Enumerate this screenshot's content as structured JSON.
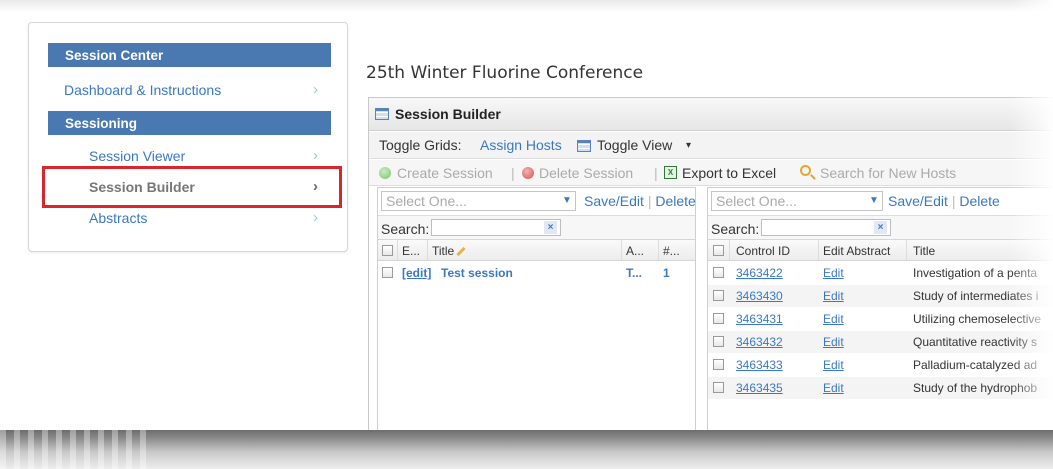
{
  "sidebar": {
    "header1": "Session Center",
    "items": [
      {
        "label": "Dashboard & Instructions"
      },
      {
        "label": "Session Viewer"
      },
      {
        "label": "Session Builder"
      },
      {
        "label": "Abstracts"
      }
    ],
    "header2": "Sessioning",
    "chevron": "›"
  },
  "conference_title": "25th Winter Fluorine Conference",
  "panel": {
    "title": "Session Builder",
    "toolbar1": {
      "toggle_grids_label": "Toggle Grids:",
      "assign_hosts": "Assign Hosts",
      "toggle_view": "Toggle View",
      "toggle_view_caret": "▾"
    },
    "toolbar2": {
      "create_session": "Create Session",
      "delete_session": "Delete Session",
      "export_excel": "Export to Excel",
      "search_hosts": "Search for New Hosts",
      "separator": "|"
    }
  },
  "left_grid": {
    "select_placeholder": "Select One...",
    "save_edit": "Save/Edit",
    "delete": "Delete",
    "search_label": "Search:",
    "clear": "×",
    "columns": [
      "E...",
      "Title",
      "A...",
      "#..."
    ],
    "rows": [
      {
        "edit": "[edit]",
        "title": "Test session",
        "a": "T...",
        "count": "1"
      }
    ]
  },
  "right_grid": {
    "select_placeholder": "Select One...",
    "save_edit": "Save/Edit",
    "delete": "Delete",
    "search_label": "Search:",
    "clear": "×",
    "columns": [
      "Control ID",
      "Edit Abstract",
      "Title"
    ],
    "rows": [
      {
        "id": "3463422",
        "edit": "Edit",
        "title": "Investigation of a penta"
      },
      {
        "id": "3463430",
        "edit": "Edit",
        "title": "Study of intermediates i"
      },
      {
        "id": "3463431",
        "edit": "Edit",
        "title": "Utilizing chemoselective"
      },
      {
        "id": "3463432",
        "edit": "Edit",
        "title": "Quantitative reactivity s"
      },
      {
        "id": "3463433",
        "edit": "Edit",
        "title": "Palladium-catalyzed ad"
      },
      {
        "id": "3463435",
        "edit": "Edit",
        "title": "Study of the hydrophob"
      }
    ]
  },
  "colors": {
    "accent": "#4a78b0",
    "link": "#3a78c4",
    "highlight": "#d9262c"
  }
}
